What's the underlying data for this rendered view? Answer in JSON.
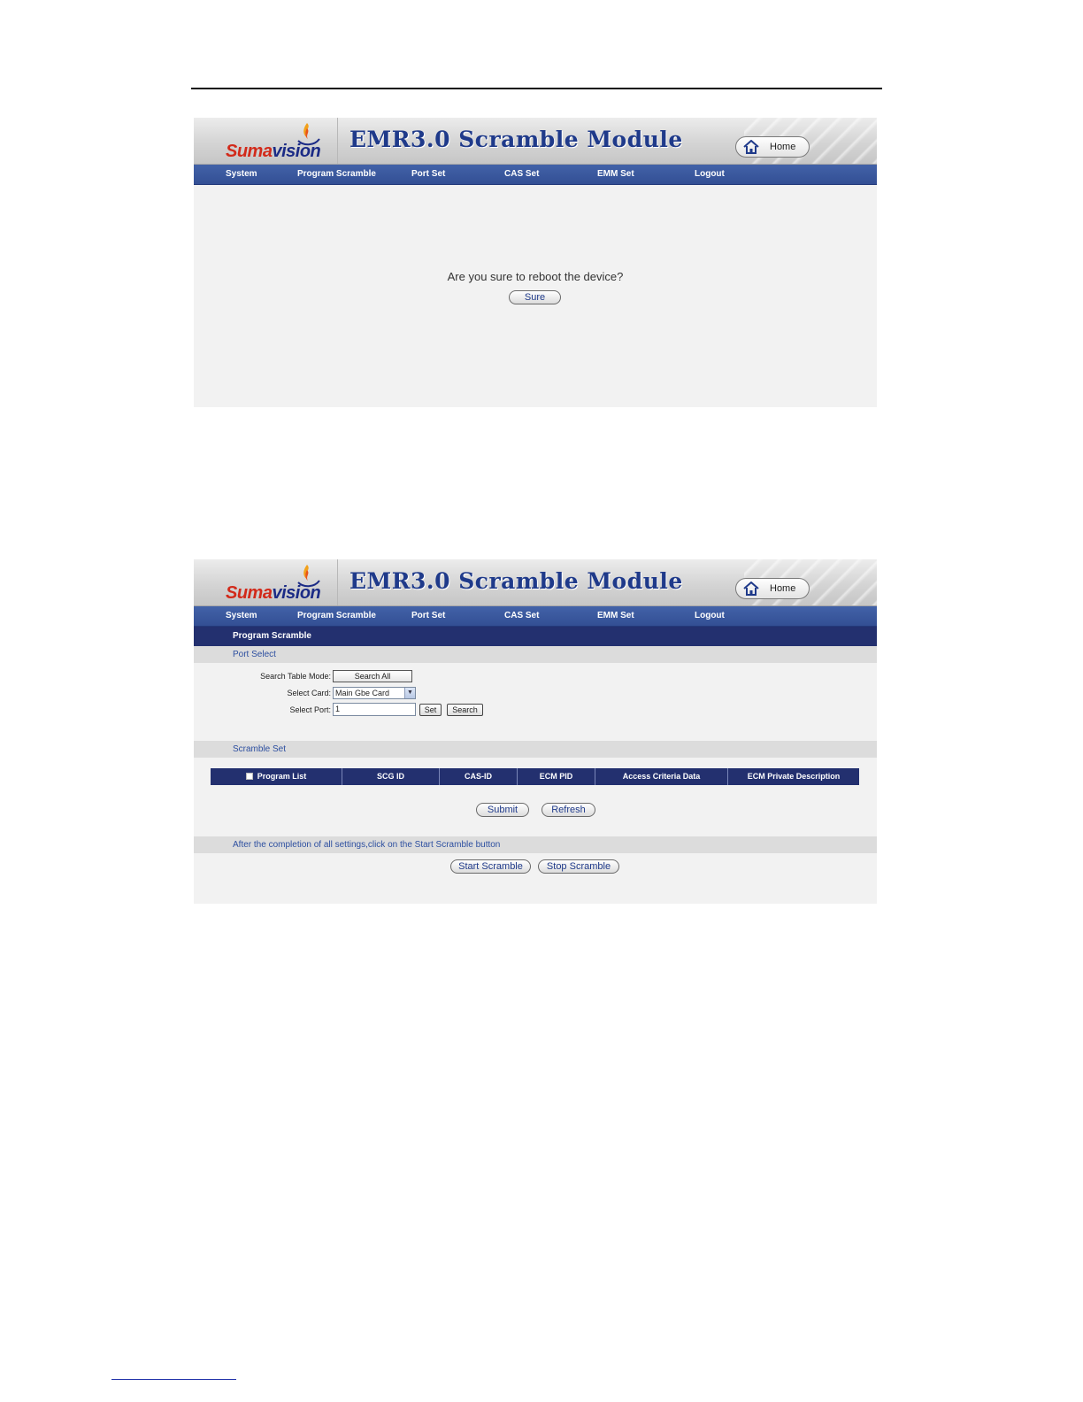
{
  "brand": {
    "logo_text_1": "Suma",
    "logo_text_2": "vision",
    "app_title": "EMR3.0 Scramble Module",
    "home_label": "Home"
  },
  "nav": [
    "System",
    "Program Scramble",
    "Port Set",
    "CAS Set",
    "EMM Set",
    "Logout"
  ],
  "reboot": {
    "message": "Are you sure to reboot the device?",
    "sure_label": "Sure"
  },
  "scramble": {
    "page_title": "Program Scramble",
    "port_select_title": "Port Select",
    "search_table_mode_label": "Search Table Mode:",
    "search_table_mode_value": "Search All",
    "select_card_label": "Select Card:",
    "select_card_value": "Main Gbe Card",
    "select_port_label": "Select Port:",
    "select_port_value": "1",
    "set_label": "Set",
    "search_label": "Search",
    "scramble_set_title": "Scramble Set",
    "columns": [
      "Program List",
      "SCG ID",
      "CAS-ID",
      "ECM PID",
      "Access Criteria Data",
      "ECM Private Description"
    ],
    "submit_label": "Submit",
    "refresh_label": "Refresh",
    "completion_note": "After the completion of all settings,click on the Start Scramble button",
    "start_label": "Start Scramble",
    "stop_label": "Stop Scramble"
  },
  "colors": {
    "nav_blue": "#3a58a0",
    "dark_navy": "#23306f",
    "title_blue": "#1f3a8a",
    "logo_red": "#d22a1a"
  }
}
